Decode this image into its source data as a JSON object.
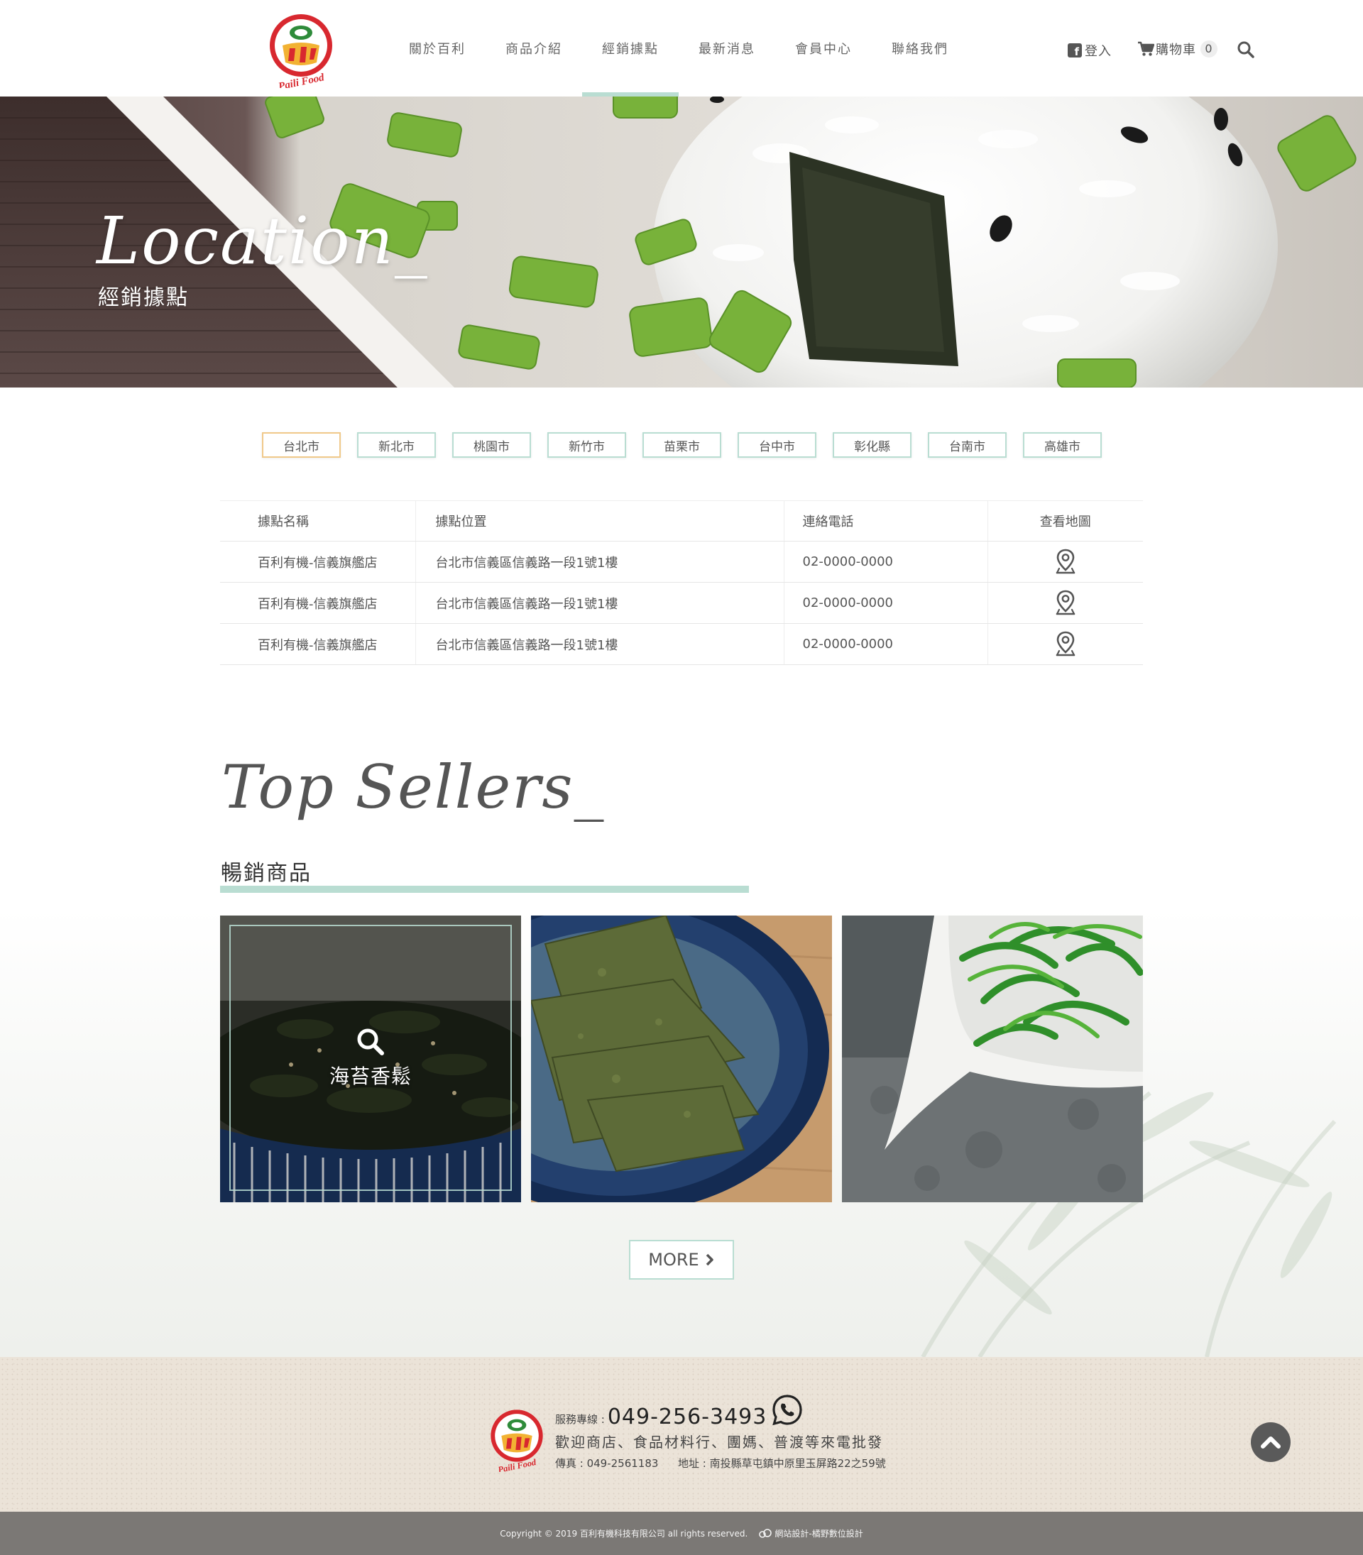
{
  "brand": {
    "logo_text": "Paili Food",
    "colors": {
      "accent": "#b9ddd2",
      "active_filter": "#f0c98a",
      "logo_red": "#d8282f",
      "logo_green": "#2e8b3a"
    }
  },
  "nav": {
    "items": [
      {
        "label": "關於百利"
      },
      {
        "label": "商品介紹"
      },
      {
        "label": "經銷據點",
        "active": true
      },
      {
        "label": "最新消息"
      },
      {
        "label": "會員中心"
      },
      {
        "label": "聯絡我們"
      }
    ]
  },
  "tools": {
    "login_label": "登入",
    "cart_label": "購物車",
    "cart_count": "0",
    "icons": [
      "facebook-icon",
      "cart-icon",
      "search-icon"
    ]
  },
  "banner": {
    "title": "Location_",
    "subtitle": "經銷據點"
  },
  "cities": [
    {
      "label": "台北市",
      "active": true
    },
    {
      "label": "新北市"
    },
    {
      "label": "桃園市"
    },
    {
      "label": "新竹市"
    },
    {
      "label": "苗栗市"
    },
    {
      "label": "台中市"
    },
    {
      "label": "彰化縣"
    },
    {
      "label": "台南市"
    },
    {
      "label": "高雄市"
    }
  ],
  "table": {
    "headers": [
      "據點名稱",
      "據點位置",
      "連絡電話",
      "查看地圖"
    ],
    "rows": [
      [
        "百利有機-信義旗艦店",
        "台北市信義區信義路一段1號1樓",
        "02-0000-0000",
        "map-pin-icon"
      ],
      [
        "百利有機-信義旗艦店",
        "台北市信義區信義路一段1號1樓",
        "02-0000-0000",
        "map-pin-icon"
      ],
      [
        "百利有機-信義旗艦店",
        "台北市信義區信義路一段1號1樓",
        "02-0000-0000",
        "map-pin-icon"
      ]
    ]
  },
  "top_sellers": {
    "title": "Top Sellers_",
    "subtitle": "暢銷商品",
    "products": [
      {
        "name": "海苔香鬆"
      },
      {
        "name": ""
      },
      {
        "name": ""
      }
    ],
    "more_label": "MORE"
  },
  "footer": {
    "phone_label": "服務專線 :",
    "phone": "049-256-3493",
    "welcome": "歡迎商店、食品材料行、團媽、普渡等來電批發",
    "fax": "傳真 : 049-2561183",
    "address": "地址 : 南投縣草屯鎮中原里玉屏路22之59號",
    "copyright": "Copyright © 2019 百利有機科技有限公司 all rights reserved.",
    "designer": "網站設計-橘野數位設計"
  }
}
